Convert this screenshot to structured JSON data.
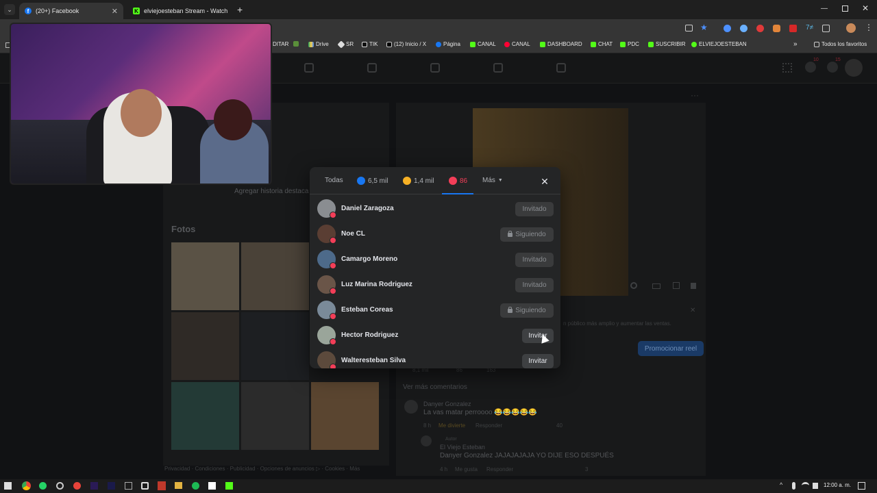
{
  "browser": {
    "tabs": [
      {
        "title": "(20+) Facebook",
        "active": true
      },
      {
        "title": "elviejoesteban Stream - Watch",
        "active": false
      }
    ],
    "new_tab": "+",
    "bookmarks": [
      "DITAR",
      "Drive",
      "SR",
      "TIK",
      "(12) Inicio / X",
      "Página",
      "CANAL",
      "CANAL",
      "DASHBOARD",
      "CHAT",
      "PDC",
      "SUSCRIBIR",
      "ELVIEJOESTEBAN"
    ],
    "bookmarks_more": "»",
    "all_favorites": "Todos los favoritos"
  },
  "facebook": {
    "notif_badges": [
      "10",
      "15"
    ],
    "left": {
      "story_hint": "Agregar historia destaca",
      "photos_title": "Fotos",
      "footer": "Privacidad · Condiciones · Publicidad · Opciones de anuncios ▷ · Cookies · Más"
    },
    "right": {
      "promo_text": "n público más amplio y aumentar las ventas.",
      "promo_button": "Promocionar reel",
      "stats": [
        "8,1 mil",
        "86",
        "163"
      ],
      "see_more": "Ver más comentarios",
      "comments": [
        {
          "author": "Danyer Gonzalez",
          "text": "La vas matar perroooo 😂😂😂😂😂",
          "time": "8 h",
          "reaction": "Me divierte",
          "reply": "Responder",
          "count": "40"
        },
        {
          "tag": "Autor",
          "author": "El Viejo Esteban",
          "text": "Danyer Gonzalez JAJAJAJAJA YO DIJE ESO DESPUÉS",
          "time": "4 h",
          "reaction": "Me gusta",
          "reply": "Responder",
          "count": "3"
        }
      ]
    }
  },
  "modal": {
    "tabs": [
      {
        "label": "Todas"
      },
      {
        "label": "6,5 mil",
        "emoji": "like"
      },
      {
        "label": "1,4 mil",
        "emoji": "haha"
      },
      {
        "label": "86",
        "emoji": "love",
        "selected": true
      },
      {
        "label": "Más",
        "dropdown": true
      }
    ],
    "close": "✕",
    "people": [
      {
        "name": "Daniel Zaragoza",
        "action": "Invitado"
      },
      {
        "name": "Noe CL",
        "action": "Siguiendo",
        "lock": true
      },
      {
        "name": "Camargo Moreno",
        "action": "Invitado"
      },
      {
        "name": "Luz Marina Rodriguez",
        "action": "Invitado"
      },
      {
        "name": "Esteban Coreas",
        "action": "Siguiendo",
        "lock": true
      },
      {
        "name": "Hector Rodriguez",
        "action": "Invitar",
        "active": true
      },
      {
        "name": "Walteresteban Silva",
        "action": "Invitar",
        "active": true
      }
    ]
  },
  "taskbar": {
    "clock": "12:00 a. m."
  },
  "colors": {
    "facebook_blue": "#1877f2",
    "love_red": "#f33e58",
    "modal_bg": "#242526"
  }
}
